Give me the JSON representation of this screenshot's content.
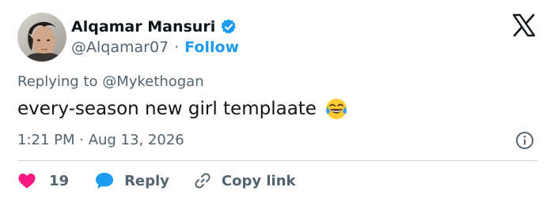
{
  "author": {
    "display_name": "Alqamar Mansuri",
    "handle": "@Alqamar07",
    "separator": "·",
    "follow_label": "Follow",
    "verified": true
  },
  "icons": {
    "avatar": "avatar",
    "verified": "verified-badge-icon",
    "platform": "x-logo-icon",
    "info": "info-icon",
    "like": "heart-icon",
    "reply": "speech-bubble-icon",
    "copy_link": "link-icon",
    "emoji": "face-with-tears-of-joy-emoji"
  },
  "reply_context": {
    "prefix": "Replying to",
    "mention": "@Mykethogan"
  },
  "tweet": {
    "text": "every-season new girl templaate"
  },
  "meta": {
    "timestamp": "1:21 PM · Aug 13, 2026"
  },
  "actions": {
    "like_count": "19",
    "reply_label": "Reply",
    "copy_link_label": "Copy link"
  },
  "colors": {
    "text_primary": "#0f1419",
    "text_secondary": "#536471",
    "accent": "#1d9bf0",
    "like": "#f91880",
    "divider": "#cfd9de"
  }
}
